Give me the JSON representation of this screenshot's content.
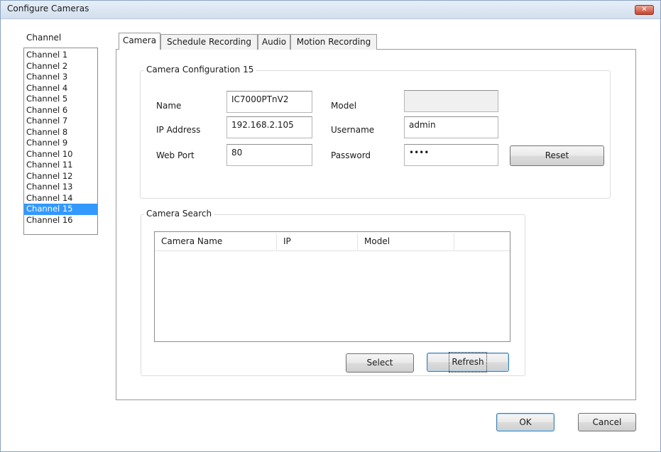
{
  "window": {
    "title": "Configure Cameras",
    "close_glyph": "✕"
  },
  "channels": {
    "label": "Channel",
    "items": [
      "Channel 1",
      "Channel 2",
      "Channel 3",
      "Channel 4",
      "Channel 5",
      "Channel 6",
      "Channel 7",
      "Channel 8",
      "Channel 9",
      "Channel 10",
      "Channel 11",
      "Channel 12",
      "Channel 13",
      "Channel 14",
      "Channel 15",
      "Channel 16"
    ],
    "selected": "Channel 15"
  },
  "tabs": [
    {
      "label": "Camera",
      "active": true
    },
    {
      "label": "Schedule Recording",
      "active": false
    },
    {
      "label": "Audio",
      "active": false
    },
    {
      "label": "Motion Recording",
      "active": false
    }
  ],
  "camera_config": {
    "title": "Camera Configuration 15",
    "name_label": "Name",
    "name_value": "IC7000PTnV2",
    "ip_label": "IP Address",
    "ip_value": "192.168.2.105",
    "port_label": "Web Port",
    "port_value": "80",
    "model_label": "Model",
    "model_value": "",
    "username_label": "Username",
    "username_value": "admin",
    "password_label": "Password",
    "password_value": "••••",
    "reset_label": "Reset"
  },
  "camera_search": {
    "title": "Camera Search",
    "columns": [
      "Camera Name",
      "IP",
      "Model"
    ],
    "rows": [],
    "select_label": "Select",
    "refresh_label": "Refresh"
  },
  "footer": {
    "ok_label": "OK",
    "cancel_label": "Cancel"
  },
  "colors": {
    "selection": "#3399ff",
    "titlebar": "#d3dfee",
    "close_button": "#c8452e"
  }
}
